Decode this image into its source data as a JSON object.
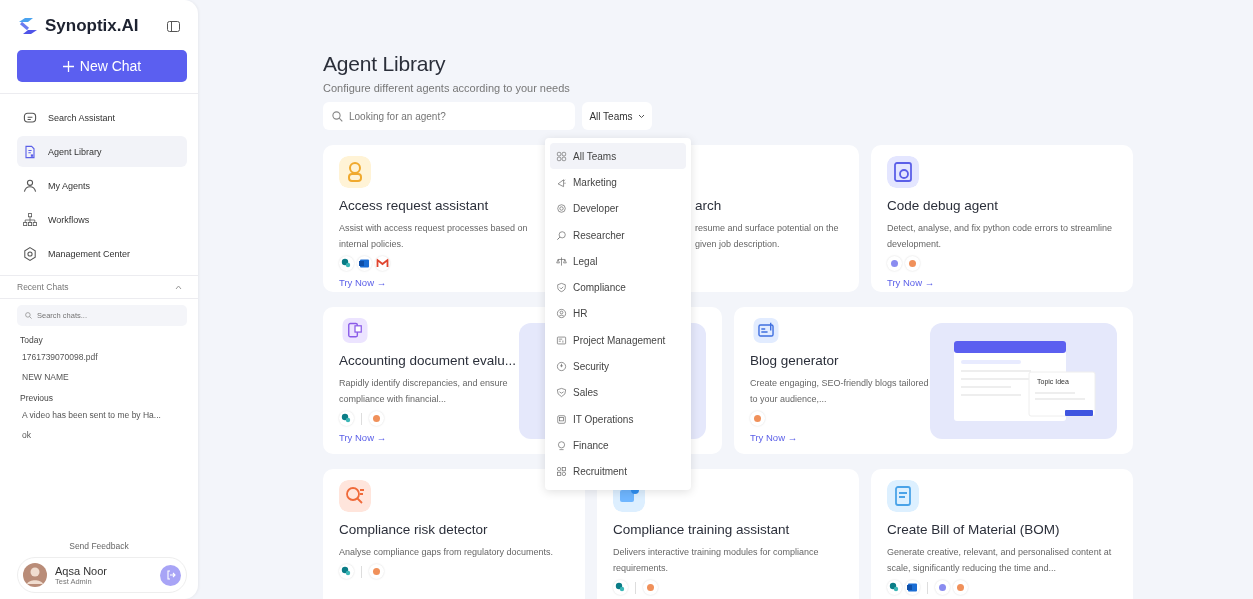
{
  "sidebar": {
    "brand": "Synoptix.AI",
    "new_chat": "New Chat",
    "nav": [
      {
        "label": "Search Assistant",
        "selected": false
      },
      {
        "label": "Agent Library",
        "selected": true
      },
      {
        "label": "My Agents",
        "selected": false
      },
      {
        "label": "Workflows",
        "selected": false
      },
      {
        "label": "Management Center",
        "selected": false
      }
    ],
    "recent": {
      "title": "Recent Chats",
      "expanded": true,
      "search_placeholder": "Search chats...",
      "groups": [
        {
          "label": "Today",
          "chats": [
            "1761739070098.pdf",
            "NEW NAME"
          ]
        },
        {
          "label": "Previous",
          "chats": [
            "A video has been sent to me by Ha...",
            "ok"
          ]
        }
      ]
    },
    "feedback": "Send Feedback",
    "user": {
      "name": "Aqsa Noor",
      "role": "Test Admin"
    }
  },
  "main": {
    "title": "Agent Library",
    "subtitle": "Configure different agents according to your needs",
    "search_placeholder": "Looking for an agent?",
    "filter": "All Teams",
    "menu": [
      {
        "label": "All Teams",
        "selected": true
      },
      {
        "label": "Marketing",
        "selected": false
      },
      {
        "label": "Developer",
        "selected": false
      },
      {
        "label": "Researcher",
        "selected": false
      },
      {
        "label": "Legal",
        "selected": false
      },
      {
        "label": "Compliance",
        "selected": false
      },
      {
        "label": "HR",
        "selected": false
      },
      {
        "label": "Project Management",
        "selected": false
      },
      {
        "label": "Security",
        "selected": false
      },
      {
        "label": "Sales",
        "selected": false
      },
      {
        "label": "IT Operations",
        "selected": false
      },
      {
        "label": "Finance",
        "selected": false
      },
      {
        "label": "Recruitment",
        "selected": false
      }
    ],
    "agents": [
      {
        "kind": "card",
        "title": "Access request assistant",
        "description": "Assist with access request processes based on internal policies.",
        "tools": [
          [
            {
              "kind": "sharepoint"
            },
            {
              "kind": "outlook"
            },
            {
              "kind": "gmail"
            }
          ]
        ],
        "action": "Try Now →"
      },
      {
        "kind": "covered",
        "title": "arch",
        "description": "resume and surface potential on the given job description."
      },
      {
        "kind": "card",
        "title": "Code debug agent",
        "description": "Detect, analyse, and fix python code errors to streamline development.",
        "tools": [
          [
            {
              "kind": "gemini"
            },
            {
              "kind": "claude"
            }
          ]
        ],
        "action": "Try Now →"
      },
      {
        "kind": "wide",
        "title": "Accounting document evalu...",
        "description": "Rapidly identify discrepancies, and ensure compliance with financial...",
        "tools": [
          [
            {
              "kind": "sharepoint"
            }
          ],
          [
            {
              "kind": "claude"
            }
          ]
        ],
        "action": "Try Now →"
      },
      {
        "kind": "wide",
        "title": "Blog generator",
        "description": "Create engaging, SEO-friendly blogs tailored to your audience,...",
        "tools": [
          [
            {
              "kind": "claude"
            }
          ]
        ],
        "action": "Try Now →",
        "preview": "Topic Idea"
      },
      {
        "kind": "card",
        "title": "Compliance risk detector",
        "description": "Analyse compliance gaps from regulatory documents.",
        "tools": [
          [
            {
              "kind": "sharepoint"
            }
          ],
          [
            {
              "kind": "claude"
            }
          ]
        ]
      },
      {
        "kind": "card",
        "title": "Compliance training assistant",
        "description": "Delivers interactive training modules for compliance requirements.",
        "tools": [
          [
            {
              "kind": "sharepoint"
            }
          ],
          [
            {
              "kind": "claude"
            }
          ]
        ]
      },
      {
        "kind": "card",
        "title": "Create Bill of Material (BOM)",
        "description": "Generate creative, relevant, and personalised content at scale, significantly reducing the time and...",
        "tools": [
          [
            {
              "kind": "sharepoint"
            },
            {
              "kind": "outlook"
            }
          ],
          [
            {
              "kind": "gemini"
            },
            {
              "kind": "claude"
            }
          ]
        ]
      }
    ]
  }
}
